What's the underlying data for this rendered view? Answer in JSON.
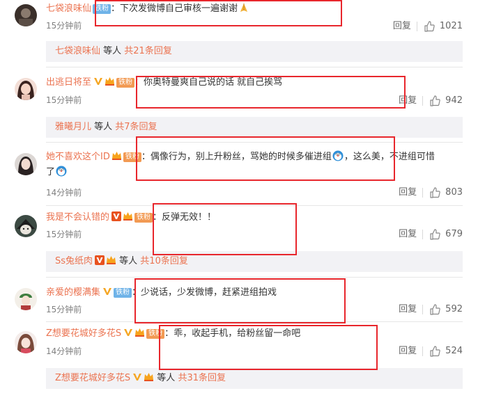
{
  "comments": [
    {
      "user": "七袋浪味仙",
      "fan_badge": "铁粉",
      "sep": "：",
      "text": "下次发微博自己审核一遍谢谢",
      "emoji": "pray-emoji",
      "time": "15分钟前",
      "reply_label": "回复",
      "likes": "1021",
      "sub": {
        "users": "七袋浪味仙",
        "middle": " 等人 ",
        "more": "共21条回复"
      }
    },
    {
      "user": "出逃日将至",
      "fan_badge": "铁粉",
      "sep": "：",
      "text": "你奥特曼爽自己说的话 就自己挨骂",
      "time": "15分钟前",
      "reply_label": "回复",
      "likes": "942",
      "sub": {
        "users": "雅曦月儿",
        "middle": " 等人 ",
        "more": "共7条回复"
      }
    },
    {
      "user": "她不喜欢这个ID",
      "fan_badge": "铁粉",
      "sep": "：",
      "text_a": "偶像行为，别上升粉丝，骂她的时候多催进组",
      "text_b": "，这么美，不进组可惜",
      "text_c": "了",
      "time": "14分钟前",
      "reply_label": "回复",
      "likes": "803"
    },
    {
      "user": "我是不会认错的",
      "fan_badge": "铁粉",
      "sep": "：",
      "text": "反弹无效！！",
      "time": "15分钟前",
      "reply_label": "回复",
      "likes": "679",
      "sub": {
        "users": "Ss兔纸肉",
        "middle": " 等人 ",
        "more": "共10条回复"
      }
    },
    {
      "user": "亲爱的樱满集",
      "fan_badge": "铁粉",
      "sep": "：",
      "text": "少说话，少发微博，赶紧进组拍戏",
      "time": "15分钟前",
      "reply_label": "回复",
      "likes": "592"
    },
    {
      "user": "Z想要花城好多花S",
      "fan_badge": "铁粉",
      "sep": "：",
      "text": "乖，收起手机，给粉丝留一命吧",
      "time": "14分钟前",
      "reply_label": "回复",
      "likes": "524",
      "sub": {
        "users": "Z想要花城好多花S",
        "middle": " 等人 ",
        "more": "共31条回复"
      }
    }
  ],
  "colors": {
    "username": "#eb7350",
    "highlight_box": "#e8262c",
    "sub_reply_bg": "#f2f2f5",
    "fan_badge_blue": "#6fb3e8",
    "fan_badge_orange": "#f29a53"
  },
  "icons": {
    "like": "thumbs-up-icon",
    "verified": "v-badge-icon",
    "crown": "crown-badge-icon"
  }
}
